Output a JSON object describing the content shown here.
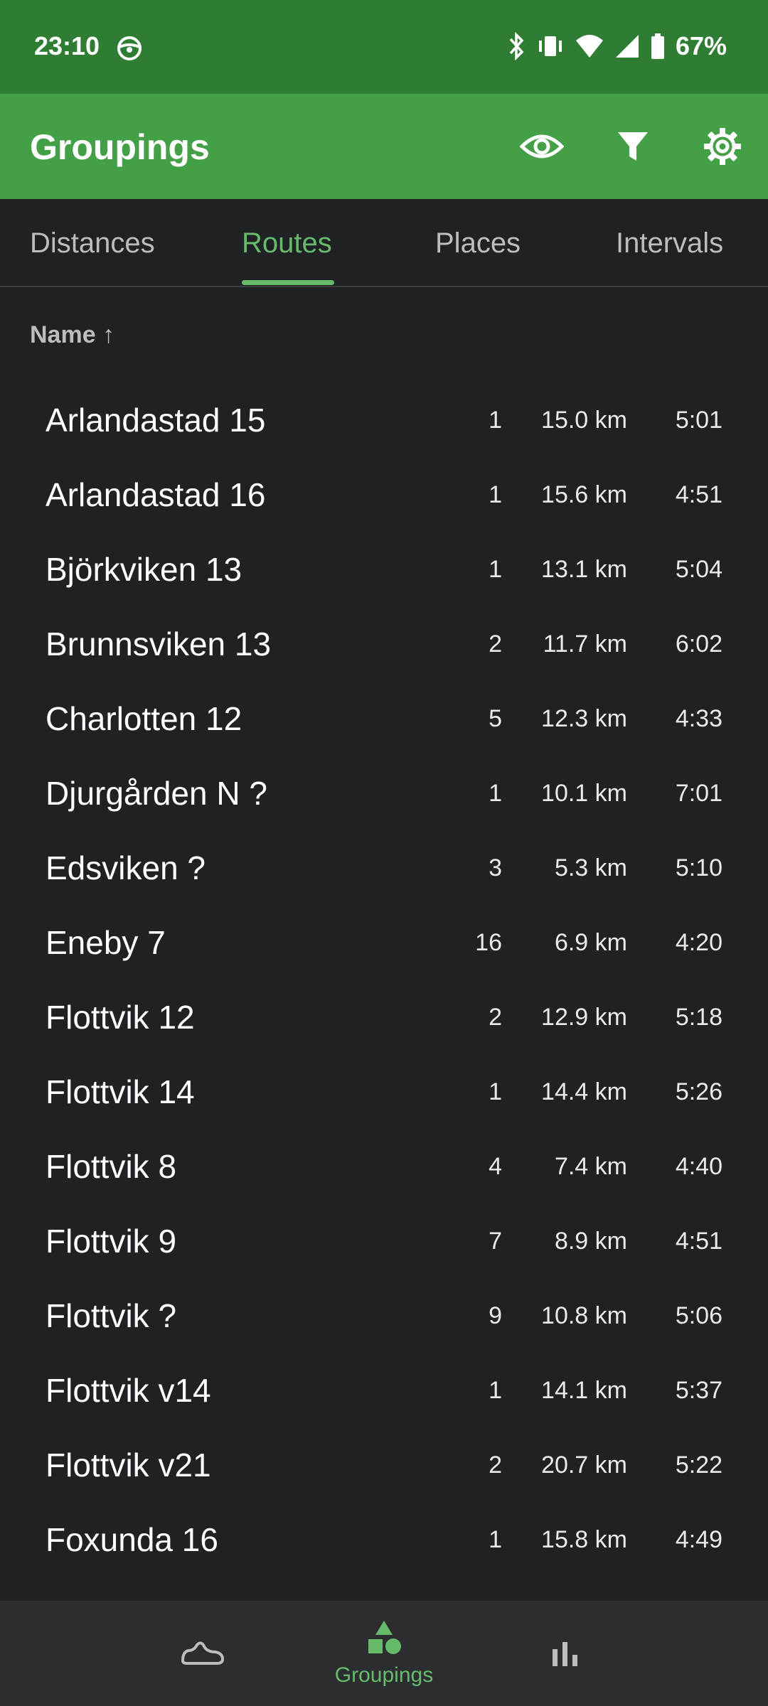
{
  "status_bar": {
    "time": "23:10",
    "battery": "67%",
    "icons": [
      "steering-wheel-icon",
      "bluetooth-icon",
      "vibrate-icon",
      "wifi-icon",
      "signal-icon",
      "battery-icon"
    ]
  },
  "app_bar": {
    "title": "Groupings",
    "actions": [
      "eye-icon",
      "filter-icon",
      "settings-icon"
    ]
  },
  "tabs": [
    {
      "label": "Distances",
      "active": false
    },
    {
      "label": "Routes",
      "active": true
    },
    {
      "label": "Places",
      "active": false
    },
    {
      "label": "Intervals",
      "active": false
    }
  ],
  "sort_header": "Name ↑",
  "routes": [
    {
      "name": "Arlandastad 15",
      "count": "1",
      "distance": "15.0 km",
      "pace": "5:01"
    },
    {
      "name": "Arlandastad 16",
      "count": "1",
      "distance": "15.6 km",
      "pace": "4:51"
    },
    {
      "name": "Björkviken 13",
      "count": "1",
      "distance": "13.1 km",
      "pace": "5:04"
    },
    {
      "name": "Brunnsviken 13",
      "count": "2",
      "distance": "11.7 km",
      "pace": "6:02"
    },
    {
      "name": "Charlotten 12",
      "count": "5",
      "distance": "12.3 km",
      "pace": "4:33"
    },
    {
      "name": "Djurgården N ?",
      "count": "1",
      "distance": "10.1 km",
      "pace": "7:01"
    },
    {
      "name": "Edsviken ?",
      "count": "3",
      "distance": "5.3 km",
      "pace": "5:10"
    },
    {
      "name": "Eneby 7",
      "count": "16",
      "distance": "6.9 km",
      "pace": "4:20"
    },
    {
      "name": "Flottvik 12",
      "count": "2",
      "distance": "12.9 km",
      "pace": "5:18"
    },
    {
      "name": "Flottvik 14",
      "count": "1",
      "distance": "14.4 km",
      "pace": "5:26"
    },
    {
      "name": "Flottvik 8",
      "count": "4",
      "distance": "7.4 km",
      "pace": "4:40"
    },
    {
      "name": "Flottvik 9",
      "count": "7",
      "distance": "8.9 km",
      "pace": "4:51"
    },
    {
      "name": "Flottvik ?",
      "count": "9",
      "distance": "10.8 km",
      "pace": "5:06"
    },
    {
      "name": "Flottvik v14",
      "count": "1",
      "distance": "14.1 km",
      "pace": "5:37"
    },
    {
      "name": "Flottvik v21",
      "count": "2",
      "distance": "20.7 km",
      "pace": "5:22"
    },
    {
      "name": "Foxunda 16",
      "count": "1",
      "distance": "15.8 km",
      "pace": "4:49"
    }
  ],
  "bottom_nav": {
    "items": [
      {
        "icon": "shoe-icon",
        "label": ""
      },
      {
        "icon": "shapes-icon",
        "label": "Groupings"
      },
      {
        "icon": "bar-chart-icon",
        "label": ""
      }
    ]
  },
  "colors": {
    "status_bar": "#2e7d32",
    "app_bar": "#43a047",
    "accent": "#66bb6a",
    "background": "#202124",
    "bottom_nav": "#2c2d30"
  }
}
